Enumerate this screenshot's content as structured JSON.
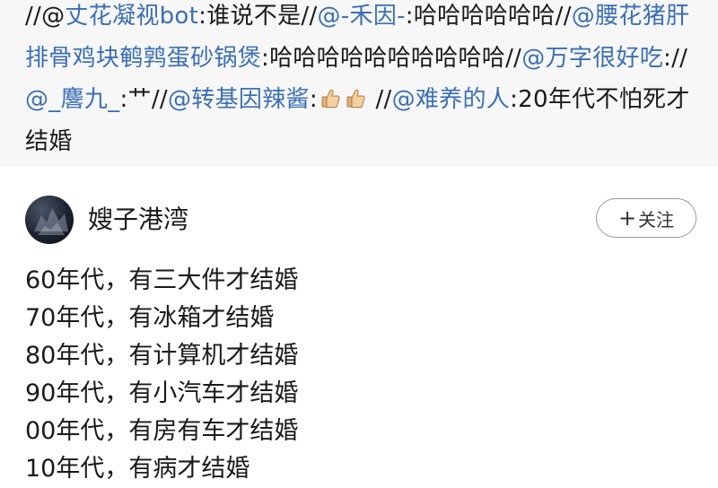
{
  "repost_chain": [
    {
      "type": "sep",
      "text": "//@"
    },
    {
      "type": "user",
      "text": "丈花凝视bot"
    },
    {
      "type": "text",
      "text": ":谁说不是"
    },
    {
      "type": "sep",
      "text": "//"
    },
    {
      "type": "user",
      "text": "@-禾因-"
    },
    {
      "type": "text",
      "text": ":哈哈哈哈哈哈"
    },
    {
      "type": "sep",
      "text": "//"
    },
    {
      "type": "user",
      "text": "@腰花猪肝排骨鸡块鹌鹑蛋砂锅煲"
    },
    {
      "type": "text",
      "text": ":哈哈哈哈哈哈哈哈哈哈"
    },
    {
      "type": "sep",
      "text": "//"
    },
    {
      "type": "user",
      "text": "@万字很好吃"
    },
    {
      "type": "text",
      "text": ":"
    },
    {
      "type": "sep",
      "text": "//"
    },
    {
      "type": "user",
      "text": "@_麐九_"
    },
    {
      "type": "text",
      "text": ":艹"
    },
    {
      "type": "sep",
      "text": "//"
    },
    {
      "type": "user",
      "text": "@转基因辣酱"
    },
    {
      "type": "text",
      "text": ":"
    },
    {
      "type": "emoji",
      "name": "thumbs-up-icon"
    },
    {
      "type": "emoji",
      "name": "thumbs-up-icon"
    },
    {
      "type": "sep",
      "text": " //"
    },
    {
      "type": "user",
      "text": "@难养的人"
    },
    {
      "type": "text",
      "text": ":20年代不怕死才结婚"
    }
  ],
  "post": {
    "author_name": "嫂子港湾",
    "follow_label": "关注",
    "follow_plus": "+",
    "lines": [
      "60年代，有三大件才结婚",
      "70年代，有冰箱才结婚",
      "80年代，有计算机才结婚",
      "90年代，有小汽车才结婚",
      "00年代，有房有车才结婚",
      "10年代，有病才结婚"
    ]
  },
  "colors": {
    "username": "#3b6fb6",
    "repost_background": "#f7f7f7",
    "text": "#1a1a1a"
  }
}
